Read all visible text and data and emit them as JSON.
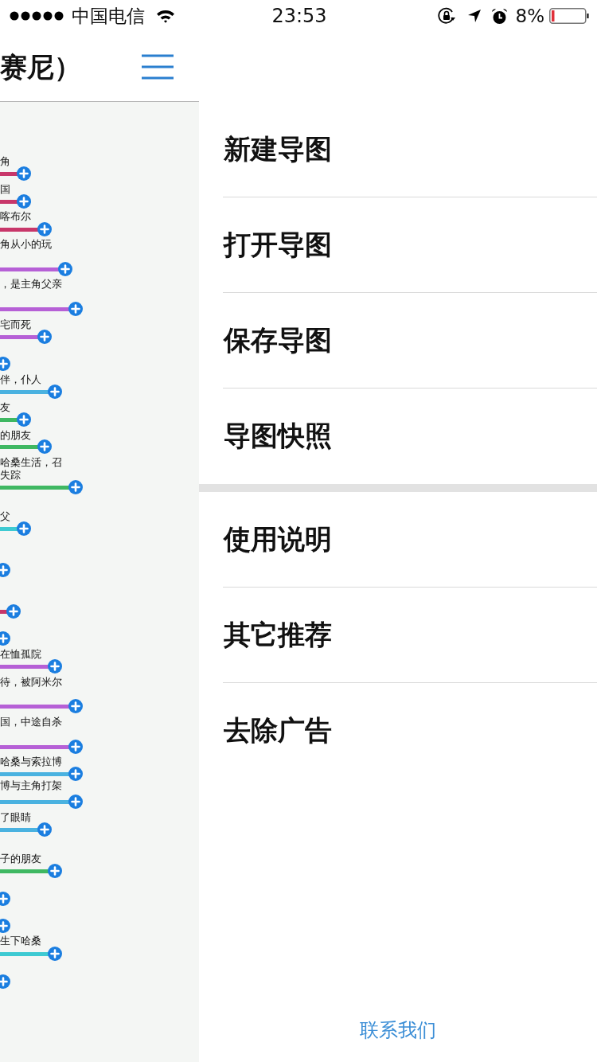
{
  "status_bar": {
    "carrier": "中国电信",
    "time": "23:53",
    "battery": "8%"
  },
  "map_panel": {
    "title": "赛尼）",
    "nodes": [
      {
        "kind": "text",
        "lines": [
          "角"
        ],
        "color": "#c8376a"
      },
      {
        "kind": "text",
        "lines": [
          "国"
        ],
        "color": "#c8376a"
      },
      {
        "kind": "text",
        "lines": [
          "喀布尔"
        ],
        "color": "#c8376a"
      },
      {
        "kind": "text",
        "lines": [
          "角从小的玩"
        ],
        "color": "#b660d6"
      },
      {
        "kind": "text",
        "lines": [
          "，是主角父亲"
        ],
        "color": "#b660d6"
      },
      {
        "kind": "text",
        "lines": [
          "宅而死"
        ],
        "color": "#b660d6"
      },
      {
        "kind": "handle"
      },
      {
        "kind": "text",
        "lines": [
          "伴，仆人"
        ],
        "color": "#4ab2e0"
      },
      {
        "kind": "text",
        "lines": [
          "友"
        ],
        "color": "#3fb862"
      },
      {
        "kind": "text",
        "lines": [
          "的朋友"
        ],
        "color": "#3fb862"
      },
      {
        "kind": "text",
        "lines": [
          "哈桑生活，召",
          "失踪"
        ],
        "color": "#3fb862"
      },
      {
        "kind": "text",
        "lines": [
          "父"
        ],
        "color": "#3ecad2"
      },
      {
        "kind": "handle"
      },
      {
        "kind": "line",
        "color": "#c8376a"
      },
      {
        "kind": "handle"
      },
      {
        "kind": "text",
        "lines": [
          "在恤孤院"
        ],
        "color": "#b660d6"
      },
      {
        "kind": "text",
        "lines": [
          "待，被阿米尔"
        ],
        "color": "#b660d6"
      },
      {
        "kind": "text",
        "lines": [
          "国，中途自杀"
        ],
        "color": "#b660d6"
      },
      {
        "kind": "text",
        "lines": [
          "哈桑与索拉博"
        ],
        "color": "#4ab2e0"
      },
      {
        "kind": "text",
        "lines": [
          "博与主角打架"
        ],
        "color": "#4ab2e0"
      },
      {
        "kind": "text",
        "lines": [
          "了眼睛"
        ],
        "color": "#4ab2e0"
      },
      {
        "kind": "text",
        "lines": [
          "子的朋友"
        ],
        "color": "#3fb862"
      },
      {
        "kind": "handle"
      },
      {
        "kind": "handle"
      },
      {
        "kind": "text",
        "lines": [
          "生下哈桑"
        ],
        "color": "#3ecad2"
      },
      {
        "kind": "handle"
      }
    ]
  },
  "menu": {
    "groups": [
      {
        "items": [
          {
            "label": "新建导图"
          },
          {
            "label": "打开导图"
          },
          {
            "label": "保存导图"
          },
          {
            "label": "导图快照"
          }
        ]
      },
      {
        "items": [
          {
            "label": "使用说明"
          },
          {
            "label": "其它推荐"
          },
          {
            "label": "去除广告"
          }
        ]
      }
    ],
    "contact_link": "联系我们"
  }
}
